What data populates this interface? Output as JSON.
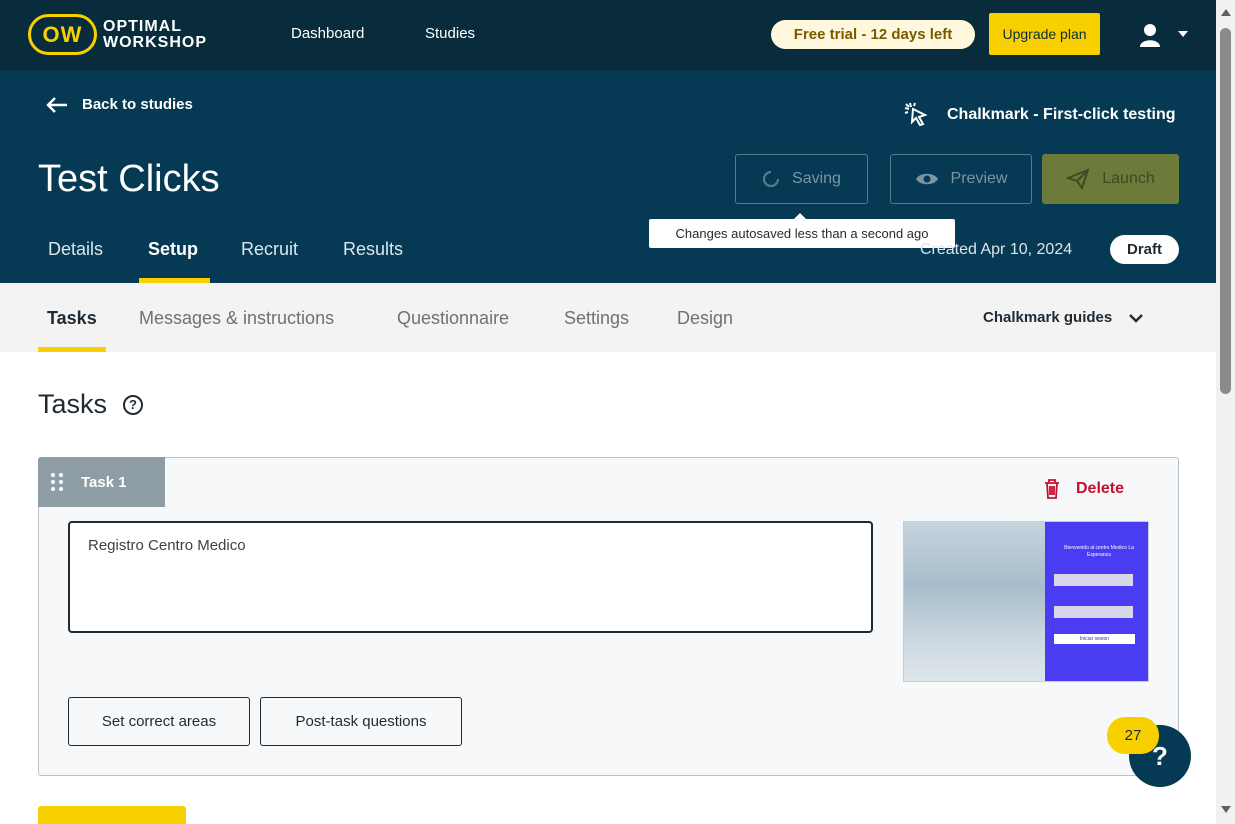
{
  "topnav": {
    "logo_mark": "OW",
    "logo_line1": "OPTIMAL",
    "logo_line2": "WORKSHOP",
    "links": [
      "Dashboard",
      "Studies"
    ],
    "trial_badge": "Free trial - 12 days left",
    "upgrade_label": "Upgrade plan"
  },
  "header": {
    "back_label": "Back to studies",
    "study_type": "Chalkmark - First-click testing",
    "title": "Test Clicks",
    "saving_label": "Saving",
    "preview_label": "Preview",
    "launch_label": "Launch",
    "tooltip": "Changes autosaved less than a second ago",
    "tabs": [
      "Details",
      "Setup",
      "Recruit",
      "Results"
    ],
    "active_tab": "Setup",
    "created": "Created Apr 10, 2024",
    "status": "Draft"
  },
  "subtabs": {
    "items": [
      "Tasks",
      "Messages & instructions",
      "Questionnaire",
      "Settings",
      "Design"
    ],
    "active": "Tasks",
    "guides_label": "Chalkmark guides"
  },
  "content": {
    "heading": "Tasks",
    "help_glyph": "?",
    "task": {
      "label": "Task 1",
      "delete_label": "Delete",
      "text": "Registro Centro Medico",
      "image_title": "Bienvenido al centro Medico La Esperanza",
      "image_button": "Iniciar sesion",
      "correct_areas_label": "Set correct areas",
      "post_task_label": "Post-task questions"
    }
  },
  "help_widget": {
    "badge_count": "27",
    "glyph": "?"
  },
  "colors": {
    "nav_bg": "#082c3c",
    "header_bg": "#063953",
    "accent": "#f8d000",
    "delete": "#c8102e"
  },
  "icons": [
    "user-icon",
    "chevron-down-icon",
    "arrow-left-icon",
    "cursor-click-icon",
    "spinner-icon",
    "eye-icon",
    "send-icon",
    "help-circle-icon",
    "drag-handle-icon",
    "trash-icon"
  ]
}
